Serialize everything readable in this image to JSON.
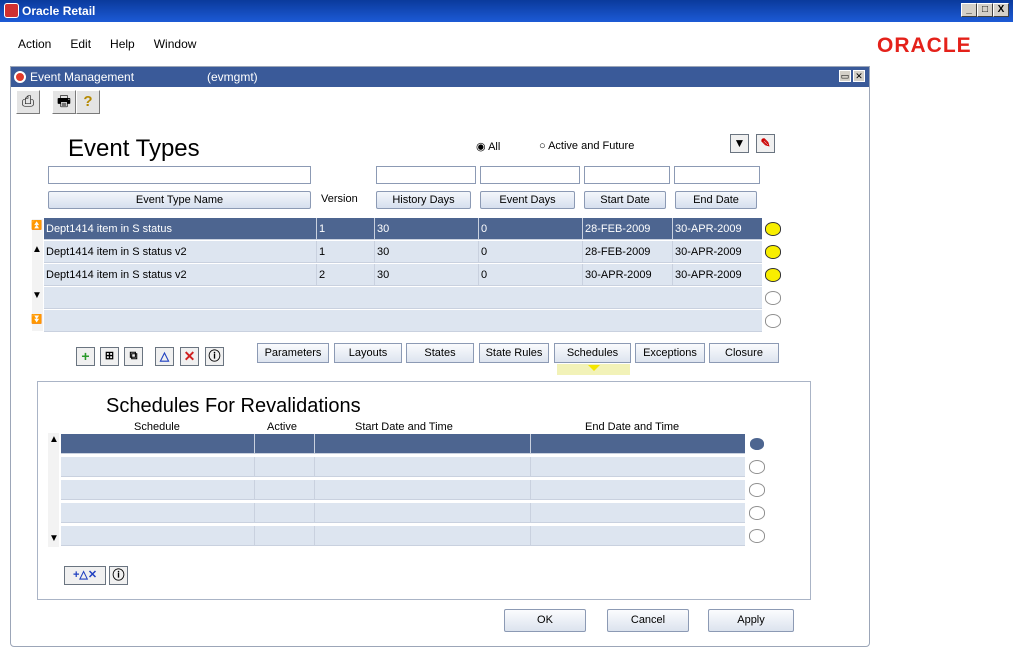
{
  "window": {
    "title": "Oracle Retail",
    "min": "_",
    "max": "□",
    "close": "X"
  },
  "menu": [
    "Action",
    "Edit",
    "Help",
    "Window"
  ],
  "brand": "ORACLE",
  "inner": {
    "title": "Event Management",
    "module": "(evmgmt)"
  },
  "page_title": "Event Types",
  "filter": {
    "all": "All",
    "active": "Active and Future"
  },
  "columns": {
    "name": "Event Type Name",
    "version": "Version",
    "history": "History Days",
    "event": "Event Days",
    "start": "Start Date",
    "end": "End Date"
  },
  "rows": [
    {
      "name": "Dept1414 item in S status",
      "version": "1",
      "history": "30",
      "event": "0",
      "start": "28-FEB-2009",
      "end": "30-APR-2009"
    },
    {
      "name": "Dept1414 item in S status v2",
      "version": "1",
      "history": "30",
      "event": "0",
      "start": "28-FEB-2009",
      "end": "30-APR-2009"
    },
    {
      "name": "Dept1414 item in S status v2",
      "version": "2",
      "history": "30",
      "event": "0",
      "start": "30-APR-2009",
      "end": "30-APR-2009"
    }
  ],
  "tabs": [
    "Parameters",
    "Layouts",
    "States",
    "State Rules",
    "Schedules",
    "Exceptions",
    "Closure"
  ],
  "section_title": "Schedules For Revalidations",
  "sched_columns": {
    "schedule": "Schedule",
    "active": "Active",
    "start": "Start Date and Time",
    "end": "End Date and Time"
  },
  "buttons": {
    "ok": "OK",
    "cancel": "Cancel",
    "apply": "Apply"
  },
  "colors": {
    "titlebar": "#1c5ad6",
    "selected_row": "#4d6590",
    "row": "#dde5f0",
    "oracle_red": "#e4211a"
  }
}
